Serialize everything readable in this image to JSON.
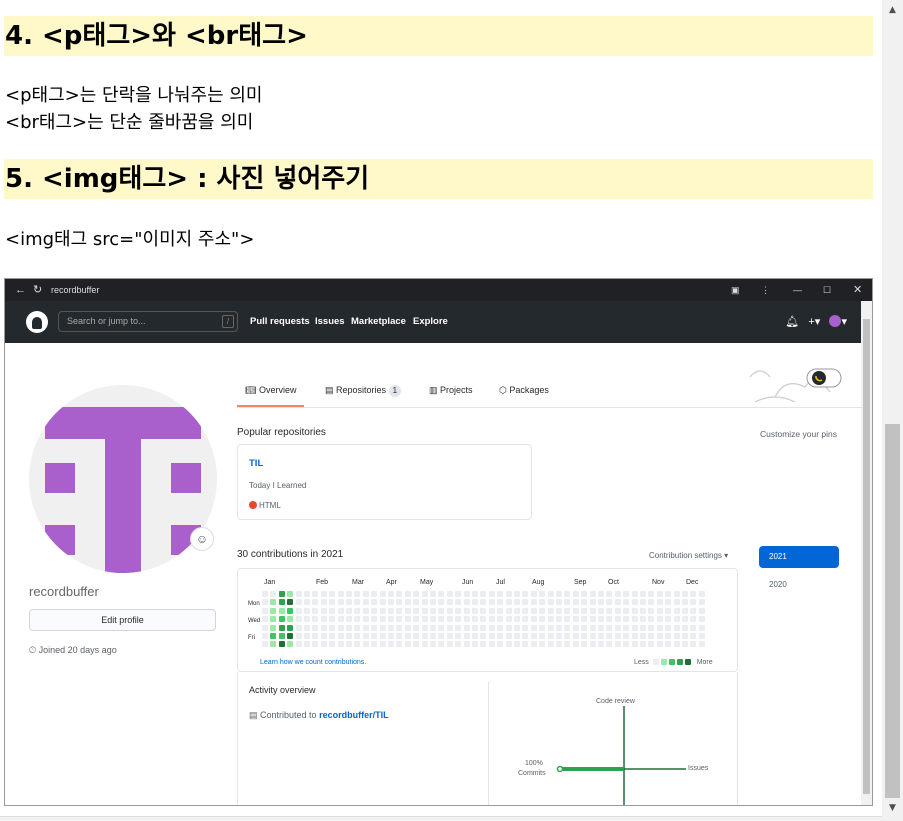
{
  "doc": {
    "h4": "4. <p태그>와 <br태그>",
    "p_line1": "<p태그>는 단락을 나눠주는 의미",
    "p_line2": "<br태그>는 단순 줄바꿈을 의미",
    "h5": "5. <img태그> : 사진 넣어주기",
    "img_line": "<img태그 src=\"이미지 주소\">"
  },
  "browser": {
    "tab_title": "recordbuffer",
    "search_placeholder": "Search or jump to...",
    "search_key": "/",
    "nav": [
      "Pull requests",
      "Issues",
      "Marketplace",
      "Explore"
    ]
  },
  "profile": {
    "username": "recordbuffer",
    "edit_label": "Edit profile",
    "joined": "Joined 20 days ago",
    "avatar_color": "#a95fcc"
  },
  "tabs": {
    "overview": "Overview",
    "repositories": "Repositories",
    "repo_count": "1",
    "projects": "Projects",
    "packages": "Packages"
  },
  "popular": {
    "label": "Popular repositories",
    "customize": "Customize your pins",
    "repo_name": "TIL",
    "repo_desc": "Today I Learned",
    "repo_lang": "HTML"
  },
  "contrib": {
    "title": "30 contributions in 2021",
    "settings": "Contribution settings ▾",
    "months": [
      "Jan",
      "Feb",
      "Mar",
      "Apr",
      "May",
      "Jun",
      "Jul",
      "Aug",
      "Sep",
      "Oct",
      "Nov",
      "Dec"
    ],
    "days": [
      "Mon",
      "Wed",
      "Fri"
    ],
    "learn": "Learn how we count contributions.",
    "less": "Less",
    "more": "More",
    "years": [
      "2021",
      "2020"
    ]
  },
  "activity": {
    "title": "Activity overview",
    "prefix": "Contributed to",
    "link": "recordbuffer/TIL",
    "code_review": "Code review",
    "commits_pct": "100%",
    "commits": "Commits",
    "issues": "Issues"
  }
}
